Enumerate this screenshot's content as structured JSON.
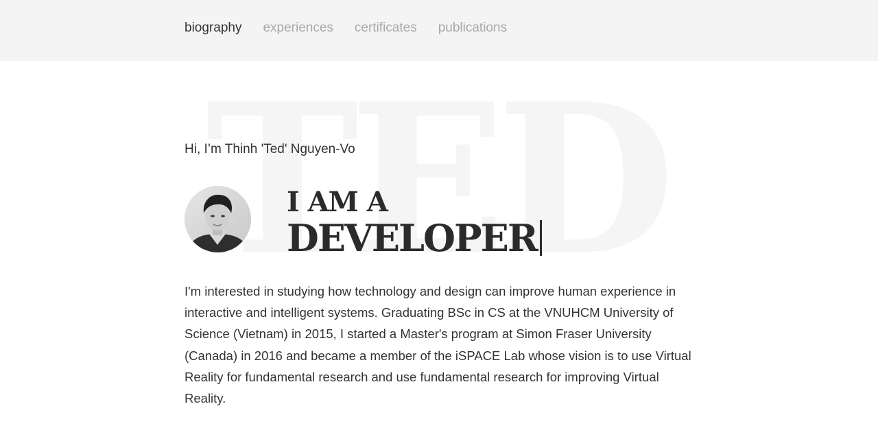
{
  "nav": {
    "items": [
      {
        "label": "biography",
        "active": true
      },
      {
        "label": "experiences",
        "active": false
      },
      {
        "label": "certificates",
        "active": false
      },
      {
        "label": "publications",
        "active": false
      }
    ]
  },
  "watermark": "TED",
  "greeting": "Hi, I’m Thinh 'Ted' Nguyen-Vo",
  "headline": {
    "line1": "I AM A",
    "line2": "DEVELOPER"
  },
  "bio": "I'm interested in studying how technology and design can improve human experience in interactive and intelligent systems. Graduating BSc in CS at the VNUHCM University of Science (Vietnam) in 2015, I started a Master's program at Simon Fraser University (Canada) in 2016 and became a member of the iSPACE Lab whose vision is to use Virtual Reality for fundamental research and use fundamental research for improving Virtual Reality.",
  "colors": {
    "nav_bg": "#f4f4f4",
    "nav_active": "#333333",
    "nav_inactive": "#a8a8a8",
    "watermark": "#f5f5f5",
    "text": "#333333"
  },
  "icons": {
    "avatar": "profile-photo"
  }
}
